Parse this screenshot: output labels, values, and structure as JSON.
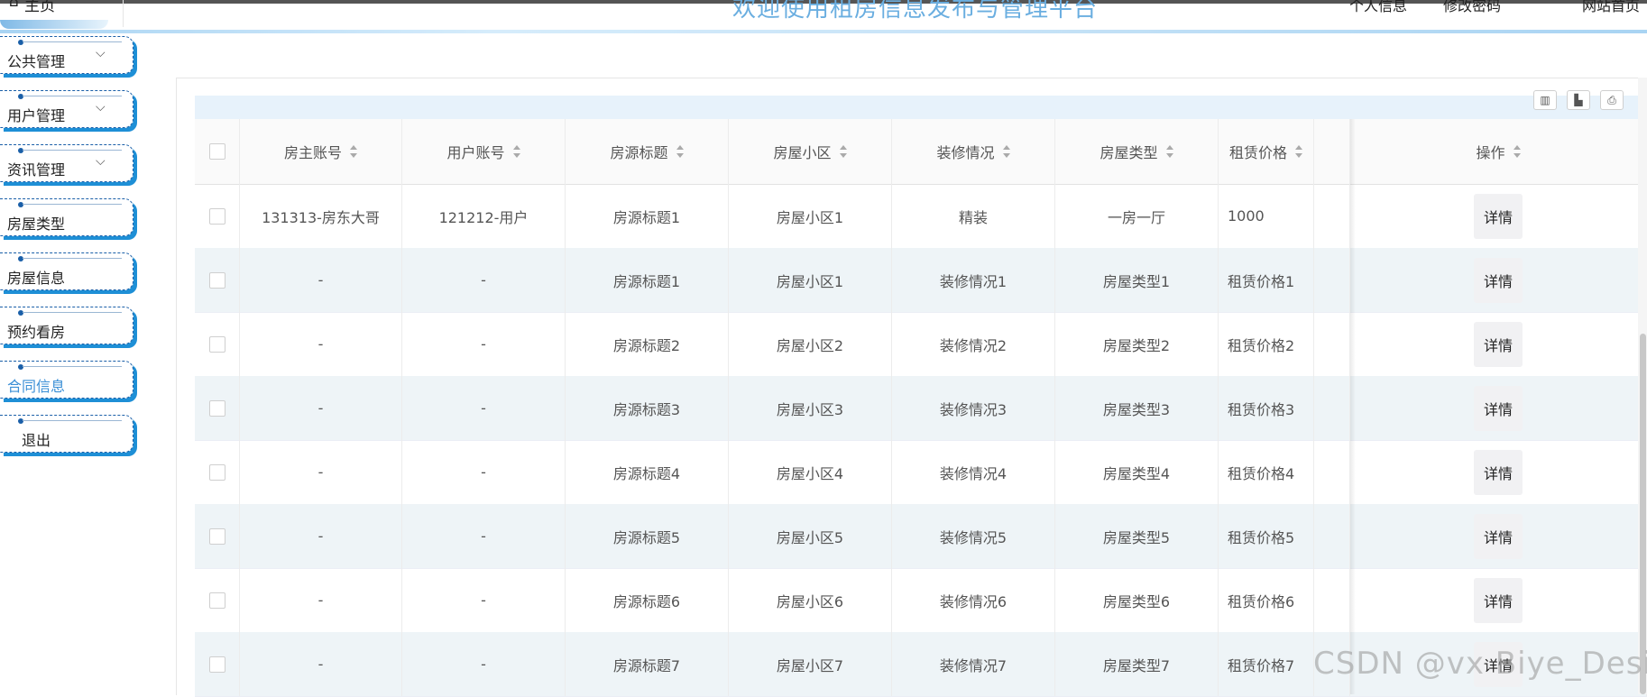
{
  "header": {
    "home_icon": "home-icon",
    "home_glyph": "⌂",
    "home_label": "主页",
    "title": "欢迎使用租房信息发布与管理平台",
    "links": [
      "个人信息",
      "修改密码",
      "网站首页"
    ]
  },
  "sidebar": {
    "items": [
      {
        "label": "公共管理",
        "chevron": "⌵",
        "active": false
      },
      {
        "label": "用户管理",
        "chevron": "⌵",
        "active": false
      },
      {
        "label": "资讯管理",
        "chevron": "⌵",
        "active": false
      },
      {
        "label": "房屋类型",
        "chevron": "",
        "active": false
      },
      {
        "label": "房屋信息",
        "chevron": "",
        "active": false
      },
      {
        "label": "预约看房",
        "chevron": "",
        "active": false
      },
      {
        "label": "合同信息",
        "chevron": "",
        "active": true
      },
      {
        "label": "退出",
        "chevron": "",
        "active": false
      }
    ]
  },
  "toolbar": {
    "icons": [
      "columns-icon",
      "export-icon",
      "print-icon"
    ],
    "glyphs": [
      "▥",
      "▙",
      "⎙"
    ]
  },
  "table": {
    "columns": [
      "房主账号",
      "用户账号",
      "房源标题",
      "房屋小区",
      "装修情况",
      "房屋类型",
      "租赁价格",
      "操作"
    ],
    "action_label": "详情",
    "rows": [
      [
        "131313-房东大哥",
        "121212-用户",
        "房源标题1",
        "房屋小区1",
        "精装",
        "一房一厅",
        "1000"
      ],
      [
        "-",
        "-",
        "房源标题1",
        "房屋小区1",
        "装修情况1",
        "房屋类型1",
        "租赁价格1"
      ],
      [
        "-",
        "-",
        "房源标题2",
        "房屋小区2",
        "装修情况2",
        "房屋类型2",
        "租赁价格2"
      ],
      [
        "-",
        "-",
        "房源标题3",
        "房屋小区3",
        "装修情况3",
        "房屋类型3",
        "租赁价格3"
      ],
      [
        "-",
        "-",
        "房源标题4",
        "房屋小区4",
        "装修情况4",
        "房屋类型4",
        "租赁价格4"
      ],
      [
        "-",
        "-",
        "房源标题5",
        "房屋小区5",
        "装修情况5",
        "房屋类型5",
        "租赁价格5"
      ],
      [
        "-",
        "-",
        "房源标题6",
        "房屋小区6",
        "装修情况6",
        "房屋类型6",
        "租赁价格6"
      ],
      [
        "-",
        "-",
        "房源标题7",
        "房屋小区7",
        "装修情况7",
        "房屋类型7",
        "租赁价格7"
      ]
    ]
  },
  "watermark": "CSDN @vx Biye_Design",
  "colors": {
    "accent": "#3b8fd6",
    "menu_shadow": "#1e8fd6",
    "title": "#6aaee0",
    "row_stripe": "#eef4f7"
  }
}
